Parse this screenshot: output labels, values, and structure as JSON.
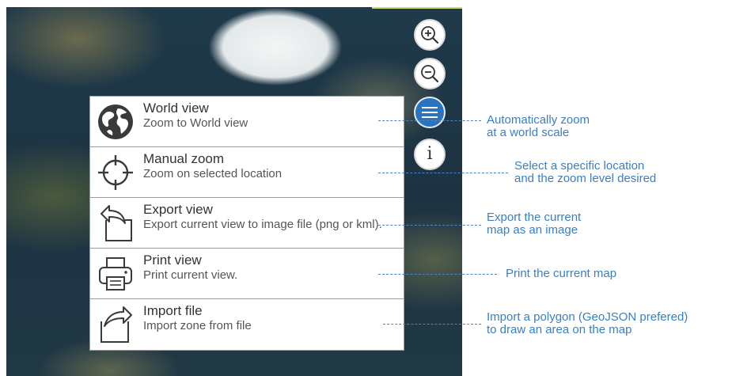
{
  "map_controls": {
    "zoom_in_icon": "zoom-in-icon",
    "zoom_out_icon": "zoom-out-icon",
    "menu_icon": "hamburger-menu-icon",
    "info_glyph": "i",
    "active_color": "#2b73bf"
  },
  "menu": {
    "items": [
      {
        "title": "World view",
        "description": "Zoom to World view",
        "icon": "globe-icon"
      },
      {
        "title": "Manual zoom",
        "description": "Zoom on selected location",
        "icon": "crosshair-icon"
      },
      {
        "title": "Export view",
        "description": "Export current view to image file (png or kml).",
        "icon": "export-icon"
      },
      {
        "title": "Print view",
        "description": "Print current view.",
        "icon": "printer-icon"
      },
      {
        "title": "Import file",
        "description": "Import zone from file",
        "icon": "import-icon"
      }
    ]
  },
  "annotations": [
    {
      "line1": "Automatically zoom",
      "line2": "at a world scale"
    },
    {
      "line1": "Select a specific location",
      "line2": "and the zoom level desired"
    },
    {
      "line1": "Export the current",
      "line2": "map as an image"
    },
    {
      "line1": "Print the current map",
      "line2": ""
    },
    {
      "line1": "Import a polygon (GeoJSON prefered)",
      "line2": "to draw an area on the map"
    }
  ],
  "annotation_color": "#3a7fc4"
}
